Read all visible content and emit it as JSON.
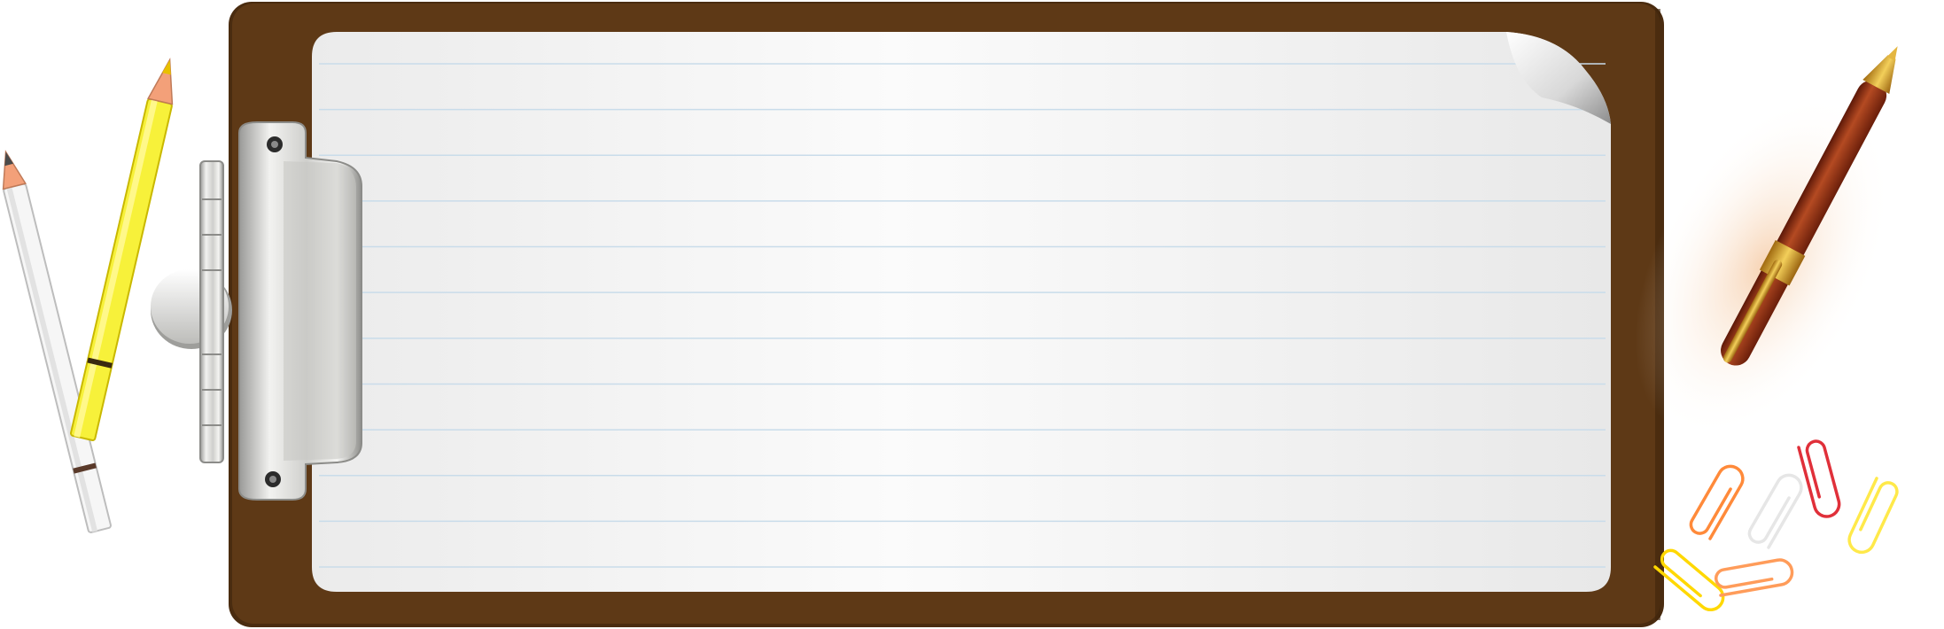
{
  "scene": {
    "objects": [
      "clipboard",
      "lined-paper",
      "metal-clip",
      "white-pencil",
      "yellow-pencil",
      "ballpoint-pen",
      "paper-clips"
    ]
  },
  "colors": {
    "clipboard": "#5e3916",
    "clipboard_edge": "#4a2c10",
    "paper": "#f4f4f4",
    "paper_lines": "#c9dcea",
    "clip_metal": "#d9d9d6",
    "pencil_yellow": "#f7f13a",
    "pencil_white": "#f6f6f6",
    "pen_body": "#8a2a12",
    "pen_gold": "#d4a020",
    "clip_colors": [
      "#ffd800",
      "#ff8a3a",
      "#e0303a",
      "#ff9c5a",
      "#ffe94a",
      "#ffffff"
    ]
  },
  "paper": {
    "line_count": 12
  }
}
